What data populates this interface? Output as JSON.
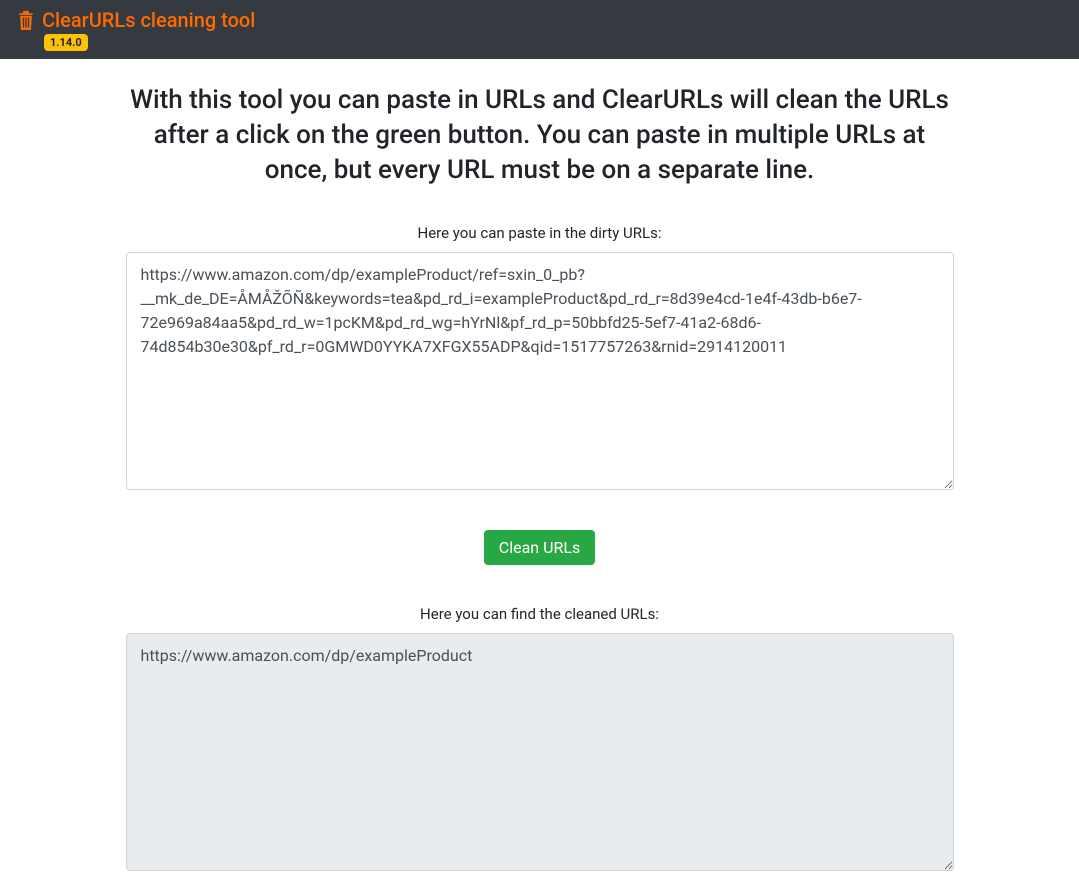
{
  "header": {
    "title": "ClearURLs cleaning tool",
    "version": "1.14.0"
  },
  "main": {
    "intro": "With this tool you can paste in URLs and ClearURLs will clean the URLs after a click on the green button. You can paste in multiple URLs at once, but every URL must be on a separate line.",
    "dirty_label": "Here you can paste in the dirty URLs:",
    "dirty_value": "https://www.amazon.com/dp/exampleProduct/ref=sxin_0_pb?__mk_de_DE=ÅMÅŽÕÑ&keywords=tea&pd_rd_i=exampleProduct&pd_rd_r=8d39e4cd-1e4f-43db-b6e7-72e969a84aa5&pd_rd_w=1pcKM&pd_rd_wg=hYrNl&pf_rd_p=50bbfd25-5ef7-41a2-68d6-74d854b30e30&pf_rd_r=0GMWD0YYKA7XFGX55ADP&qid=1517757263&rnid=2914120011",
    "clean_button": "Clean URLs",
    "cleaned_label": "Here you can find the cleaned URLs:",
    "cleaned_value": "https://www.amazon.com/dp/exampleProduct"
  }
}
